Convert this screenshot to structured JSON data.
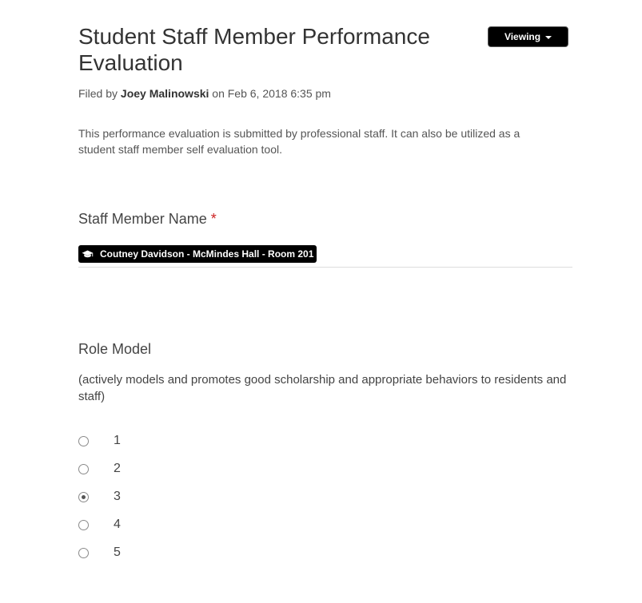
{
  "header": {
    "title": "Student Staff Member Performance Evaluation",
    "viewing_label": "Viewing",
    "filed_by_prefix": "Filed by",
    "author": "Joey Malinowski",
    "filed_on": "on Feb 6, 2018 6:35 pm"
  },
  "description": "This performance evaluation is submitted by professional staff. It can also be utilized as a student staff member self evaluation tool.",
  "staff_field": {
    "label": "Staff Member Name",
    "required_mark": "*",
    "value": "Coutney Davidson - McMindes Hall - Room 201",
    "icon": "graduation-cap-icon"
  },
  "role_model": {
    "label": "Role Model",
    "description": "(actively models and promotes good scholarship and appropriate behaviors to residents and staff)",
    "options": [
      "1",
      "2",
      "3",
      "4",
      "5"
    ],
    "selected": "3"
  }
}
